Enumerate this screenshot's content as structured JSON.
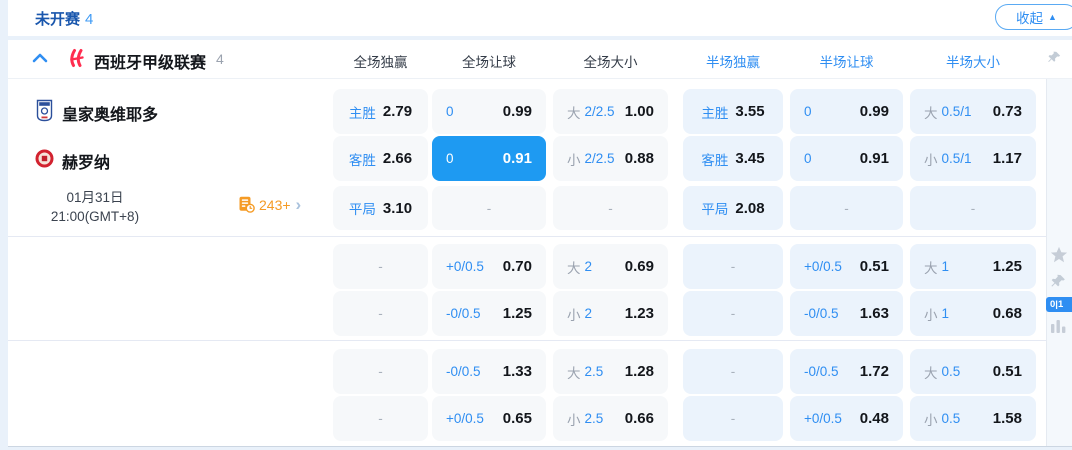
{
  "topbar": {
    "status_label": "未开赛",
    "status_count": "4",
    "collapse_label": "收起",
    "collapse_icon": "▲"
  },
  "league": {
    "name": "西班牙甲级联赛",
    "count": "4"
  },
  "columns": [
    "全场独赢",
    "全场让球",
    "全场大小",
    "半场独赢",
    "半场让球",
    "半场大小"
  ],
  "match": {
    "home_team": "皇家奥维耶多",
    "away_team": "赫罗纳",
    "date": "01月31日",
    "time": "21:00(GMT+8)",
    "more_markets_count": "243+",
    "more_markets_icon": "›"
  },
  "side_panel": {
    "corner_badge": "0|1",
    "icons": [
      "pin-icon",
      "star-icon",
      "pin-icon",
      "corner-stat-badge",
      "bar-chart-icon"
    ]
  },
  "colors": {
    "accent_blue": "#2f8ef2",
    "selected_cell": "#1e9af2",
    "full_cell_bg": "#f6f8fa",
    "half_cell_bg": "#ebf3fc",
    "orange": "#f59b25"
  },
  "odds": {
    "rows": [
      {
        "cells": [
          {
            "type": "win",
            "label": "主胜",
            "value": "2.79"
          },
          {
            "type": "hcp",
            "label": "0",
            "value": "0.99"
          },
          {
            "type": "ou",
            "tag": "大",
            "line": "2/2.5",
            "value": "1.00"
          },
          {
            "type": "win",
            "label": "主胜",
            "value": "3.55"
          },
          {
            "type": "hcp",
            "label": "0",
            "value": "0.99"
          },
          {
            "type": "ou",
            "tag": "大",
            "line": "0.5/1",
            "value": "0.73"
          }
        ]
      },
      {
        "cells": [
          {
            "type": "win",
            "label": "客胜",
            "value": "2.66"
          },
          {
            "type": "hcp",
            "label": "0",
            "value": "0.91",
            "selected": true
          },
          {
            "type": "ou",
            "tag": "小",
            "line": "2/2.5",
            "value": "0.88"
          },
          {
            "type": "win",
            "label": "客胜",
            "value": "3.45"
          },
          {
            "type": "hcp",
            "label": "0",
            "value": "0.91"
          },
          {
            "type": "ou",
            "tag": "小",
            "line": "0.5/1",
            "value": "1.17"
          }
        ]
      },
      {
        "cells": [
          {
            "type": "win",
            "label": "平局",
            "value": "3.10"
          },
          {
            "type": "dash",
            "value": "-"
          },
          {
            "type": "dash",
            "value": "-"
          },
          {
            "type": "win",
            "label": "平局",
            "value": "2.08"
          },
          {
            "type": "dash",
            "value": "-"
          },
          {
            "type": "dash",
            "value": "-"
          }
        ]
      },
      {
        "cells": [
          {
            "type": "dash",
            "value": "-"
          },
          {
            "type": "hcp",
            "label": "+0/0.5",
            "value": "0.70"
          },
          {
            "type": "ou",
            "tag": "大",
            "line": "2",
            "value": "0.69"
          },
          {
            "type": "dash",
            "value": "-"
          },
          {
            "type": "hcp",
            "label": "+0/0.5",
            "value": "0.51"
          },
          {
            "type": "ou",
            "tag": "大",
            "line": "1",
            "value": "1.25"
          }
        ]
      },
      {
        "cells": [
          {
            "type": "dash",
            "value": "-"
          },
          {
            "type": "hcp",
            "label": "-0/0.5",
            "value": "1.25"
          },
          {
            "type": "ou",
            "tag": "小",
            "line": "2",
            "value": "1.23"
          },
          {
            "type": "dash",
            "value": "-"
          },
          {
            "type": "hcp",
            "label": "-0/0.5",
            "value": "1.63"
          },
          {
            "type": "ou",
            "tag": "小",
            "line": "1",
            "value": "0.68"
          }
        ]
      },
      {
        "cells": [
          {
            "type": "dash",
            "value": "-"
          },
          {
            "type": "hcp",
            "label": "-0/0.5",
            "value": "1.33"
          },
          {
            "type": "ou",
            "tag": "大",
            "line": "2.5",
            "value": "1.28"
          },
          {
            "type": "dash",
            "value": "-"
          },
          {
            "type": "hcp",
            "label": "-0/0.5",
            "value": "1.72"
          },
          {
            "type": "ou",
            "tag": "大",
            "line": "0.5",
            "value": "0.51"
          }
        ]
      },
      {
        "cells": [
          {
            "type": "dash",
            "value": "-"
          },
          {
            "type": "hcp",
            "label": "+0/0.5",
            "value": "0.65"
          },
          {
            "type": "ou",
            "tag": "小",
            "line": "2.5",
            "value": "0.66"
          },
          {
            "type": "dash",
            "value": "-"
          },
          {
            "type": "hcp",
            "label": "+0/0.5",
            "value": "0.48"
          },
          {
            "type": "ou",
            "tag": "小",
            "line": "0.5",
            "value": "1.58"
          }
        ]
      }
    ]
  }
}
